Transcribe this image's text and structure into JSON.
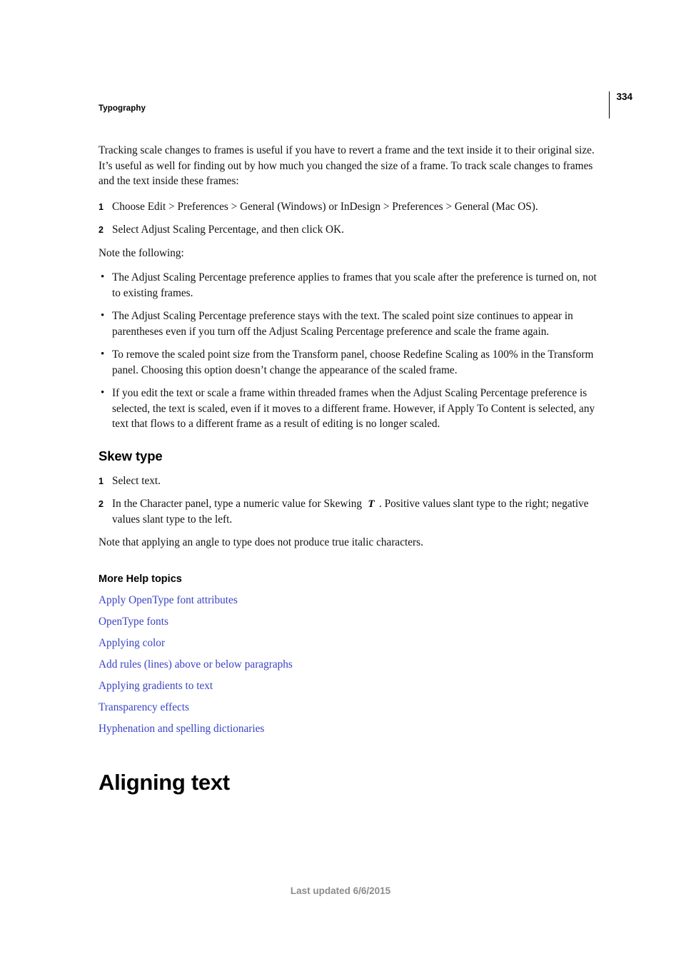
{
  "header": {
    "section_title": "Typography",
    "page_number": "334"
  },
  "body": {
    "intro_paragraph": "Tracking scale changes to frames is useful if you have to revert a frame and the text inside it to their original size. It’s useful as well for finding out by how much you changed the size of a frame. To track scale changes to frames and the text inside these frames:",
    "steps": [
      {
        "marker": "1",
        "text": "Choose Edit > Preferences > General (Windows) or InDesign > Preferences > General (Mac OS)."
      },
      {
        "marker": "2",
        "text": "Select Adjust Scaling Percentage, and then click OK."
      }
    ],
    "note_intro": "Note the following:",
    "bullets": [
      {
        "marker": "•",
        "text": "The Adjust Scaling Percentage preference applies to frames that you scale after the preference is turned on, not to existing frames."
      },
      {
        "marker": "•",
        "text": "The Adjust Scaling Percentage preference stays with the text. The scaled point size continues to appear in parentheses even if you turn off the Adjust Scaling Percentage preference and scale the frame again."
      },
      {
        "marker": "•",
        "text": "To remove the scaled point size from the Transform panel, choose Redefine Scaling as 100% in the Transform panel. Choosing this option doesn’t change the appearance of the scaled frame."
      },
      {
        "marker": "•",
        "text": "If you edit the text or scale a frame within threaded frames when the Adjust Scaling Percentage preference is selected, the text is scaled, even if it moves to a different frame. However, if Apply To Content is selected, any text that flows to a different frame as a result of editing is no longer scaled."
      }
    ]
  },
  "skew_section": {
    "heading": "Skew type",
    "step1_marker": "1",
    "step1_text": "Select text.",
    "step2_marker": "2",
    "step2_text_before": "In the Character panel, type a numeric value for Skewing",
    "skew_icon_name": "skew-type-icon",
    "step2_text_after": ". Positive values slant type to the right; negative values slant type to the left.",
    "note": "Note that applying an angle to type does not produce true italic characters."
  },
  "more_help": {
    "heading": "More Help topics",
    "links": [
      "Apply OpenType font attributes",
      "OpenType fonts",
      "Applying color",
      "Add rules (lines) above or below paragraphs",
      "Applying gradients to text",
      "Transparency effects",
      "Hyphenation and spelling dictionaries"
    ]
  },
  "chapter": {
    "title": "Aligning text"
  },
  "footer": {
    "text": "Last updated 6/6/2015"
  },
  "colors": {
    "link": "#3843c4",
    "footer_text": "#8c8c8c",
    "body_text": "#111111"
  }
}
